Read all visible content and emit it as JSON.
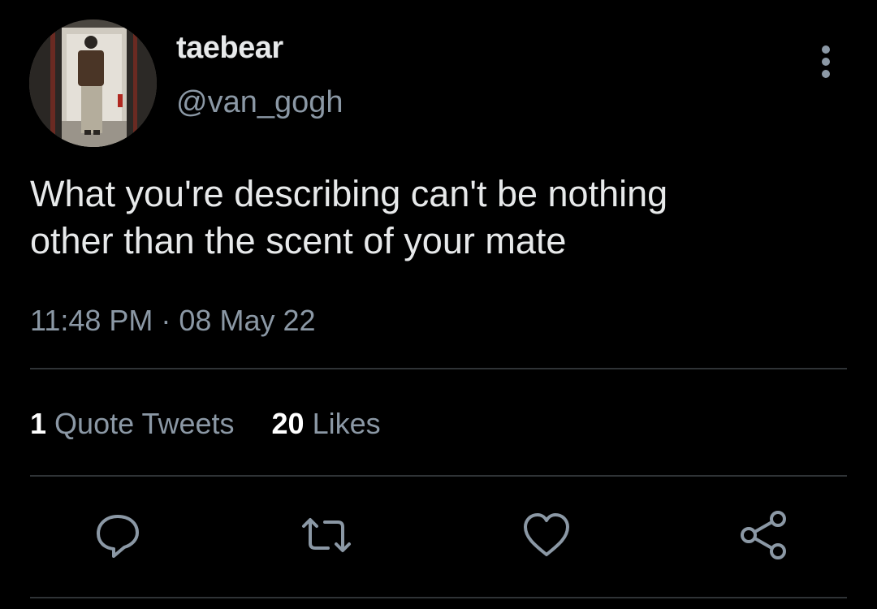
{
  "user": {
    "display_name": "taebear",
    "handle": "@van_gogh",
    "avatar_icon": "profile-photo"
  },
  "tweet": {
    "text_line1": "What you're describing can't be nothing",
    "text_line2": "other than the scent of your mate",
    "timestamp": "11:48 PM · 08 May 22"
  },
  "stats": {
    "quote_tweets_count": "1",
    "quote_tweets_label": "Quote Tweets",
    "likes_count": "20",
    "likes_label": "Likes"
  },
  "actions": {
    "reply_icon": "reply-icon",
    "retweet_icon": "retweet-icon",
    "like_icon": "heart-icon",
    "share_icon": "share-icon",
    "more_icon": "more-vertical-icon"
  },
  "colors": {
    "background": "#000000",
    "primary_text": "#e7e9ea",
    "secondary_text": "#8b98a5",
    "divider": "#2f3336"
  }
}
